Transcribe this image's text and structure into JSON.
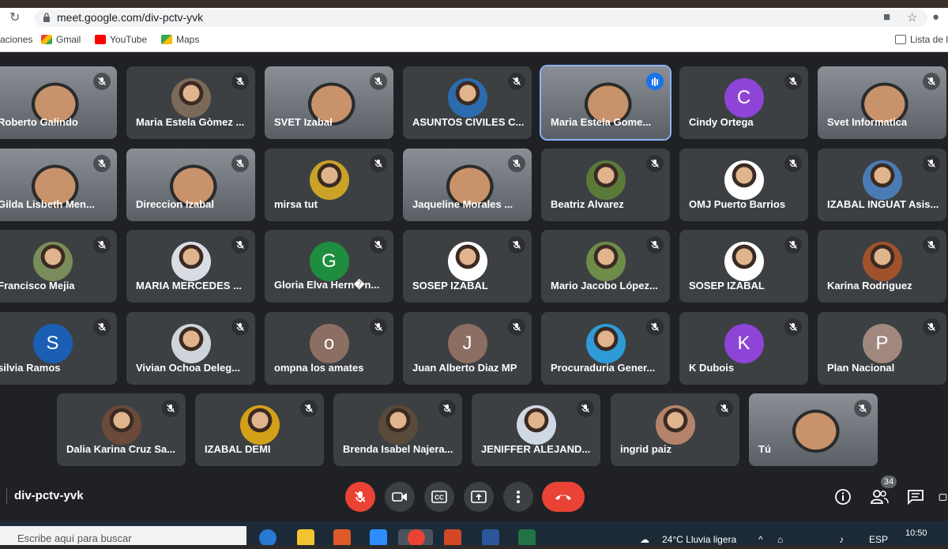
{
  "browser": {
    "url": "meet.google.com/div-pctv-yvk",
    "bookmarks": [
      {
        "label": "aciones"
      },
      {
        "label": "Gmail"
      },
      {
        "label": "YouTube"
      },
      {
        "label": "Maps"
      }
    ],
    "reading_list_label": "Lista de l"
  },
  "participants": [
    {
      "name": "Roberto Galindo",
      "initial": "",
      "avatar_color": "#3c4043",
      "kind": "video",
      "speaking": false
    },
    {
      "name": "Maria Estela Gòmez ...",
      "initial": "",
      "avatar_color": "#7b6a5a",
      "kind": "photo",
      "speaking": false
    },
    {
      "name": "SVET Izabal",
      "initial": "",
      "avatar_color": "#3c4043",
      "kind": "video",
      "speaking": false
    },
    {
      "name": "ASUNTOS CIVILES C...",
      "initial": "",
      "avatar_color": "#2b6cb0",
      "kind": "photo",
      "speaking": false
    },
    {
      "name": "Maria Estela Gome...",
      "initial": "",
      "avatar_color": "#3c4043",
      "kind": "video",
      "speaking": true
    },
    {
      "name": "Cindy Ortega",
      "initial": "C",
      "avatar_color": "#8e44d6",
      "kind": "initial",
      "speaking": false
    },
    {
      "name": "Svet Informatica",
      "initial": "",
      "avatar_color": "#3c4043",
      "kind": "video",
      "speaking": false
    },
    {
      "name": "Gilda Lisbeth Men...",
      "initial": "",
      "avatar_color": "#3c4043",
      "kind": "video",
      "speaking": false
    },
    {
      "name": "Direccion Izabal",
      "initial": "",
      "avatar_color": "#3c4043",
      "kind": "video",
      "speaking": false
    },
    {
      "name": "mirsa tut",
      "initial": "",
      "avatar_color": "#c9a227",
      "kind": "photo",
      "speaking": false
    },
    {
      "name": "Jaqueline Morales ...",
      "initial": "",
      "avatar_color": "#3c4043",
      "kind": "video",
      "speaking": false
    },
    {
      "name": "Beatriz Alvarez",
      "initial": "",
      "avatar_color": "#5b7a3a",
      "kind": "photo",
      "speaking": false
    },
    {
      "name": "OMJ Puerto Barrios",
      "initial": "",
      "avatar_color": "#ffffff",
      "kind": "photo",
      "speaking": false
    },
    {
      "name": "IZABAL INGUAT Asis...",
      "initial": "",
      "avatar_color": "#4b7bb5",
      "kind": "photo",
      "speaking": false
    },
    {
      "name": "Francisco Mejia",
      "initial": "",
      "avatar_color": "#7a8c5a",
      "kind": "photo",
      "speaking": false
    },
    {
      "name": "MARIA MERCEDES ...",
      "initial": "",
      "avatar_color": "#d9dde3",
      "kind": "photo",
      "speaking": false
    },
    {
      "name": "Gloria Elva Hern�n...",
      "initial": "G",
      "avatar_color": "#1e8e3e",
      "kind": "initial",
      "speaking": false
    },
    {
      "name": "SOSEP IZABAL",
      "initial": "",
      "avatar_color": "#ffffff",
      "kind": "photo",
      "speaking": false
    },
    {
      "name": "Mario Jacobo López...",
      "initial": "",
      "avatar_color": "#6d8c4a",
      "kind": "photo",
      "speaking": false
    },
    {
      "name": "SOSEP IZABAL",
      "initial": "",
      "avatar_color": "#ffffff",
      "kind": "photo",
      "speaking": false
    },
    {
      "name": "Karina Rodriguez",
      "initial": "",
      "avatar_color": "#a0522d",
      "kind": "photo",
      "speaking": false
    },
    {
      "name": "silvia Ramos",
      "initial": "S",
      "avatar_color": "#1a5fb4",
      "kind": "initial",
      "speaking": false
    },
    {
      "name": "Vivian Ochoa Deleg...",
      "initial": "",
      "avatar_color": "#cfd4da",
      "kind": "photo",
      "speaking": false
    },
    {
      "name": "ompna los amates",
      "initial": "o",
      "avatar_color": "#8d6e63",
      "kind": "initial",
      "speaking": false
    },
    {
      "name": "Juan Alberto Diaz MP",
      "initial": "J",
      "avatar_color": "#8d6e63",
      "kind": "initial",
      "speaking": false
    },
    {
      "name": "Procuraduria Gener...",
      "initial": "",
      "avatar_color": "#2e9bd6",
      "kind": "photo",
      "speaking": false
    },
    {
      "name": "K Dubois",
      "initial": "K",
      "avatar_color": "#8e44d6",
      "kind": "initial",
      "speaking": false
    },
    {
      "name": "Plan Nacional",
      "initial": "P",
      "avatar_color": "#a1887f",
      "kind": "initial",
      "speaking": false
    },
    {
      "name": "Dalia Karina Cruz Sa...",
      "initial": "",
      "avatar_color": "#6b4a3a",
      "kind": "photo",
      "speaking": false
    },
    {
      "name": "IZABAL DEMI",
      "initial": "",
      "avatar_color": "#d4a017",
      "kind": "photo",
      "speaking": false
    },
    {
      "name": "Brenda Isabel Najera...",
      "initial": "",
      "avatar_color": "#5a4a3a",
      "kind": "photo",
      "speaking": false
    },
    {
      "name": "JENIFFER ALEJAND...",
      "initial": "",
      "avatar_color": "#cfd8e3",
      "kind": "photo",
      "speaking": false
    },
    {
      "name": "ingrid paiz",
      "initial": "",
      "avatar_color": "#b5836a",
      "kind": "photo",
      "speaking": false
    },
    {
      "name": "Tú",
      "initial": "",
      "avatar_color": "#3c4043",
      "kind": "video",
      "speaking": false
    }
  ],
  "meeting": {
    "code": "div-pctv-yvk",
    "participant_count": "34"
  },
  "colors": {
    "accent": "#8ab4f8",
    "end_call": "#ea4335",
    "tile_bg": "#3c4043",
    "page_bg": "#202124"
  },
  "taskbar": {
    "search_placeholder": "Escribe aquí para buscar",
    "weather": "24°C  Lluvia ligera",
    "language": "ESP",
    "time": "10:50"
  }
}
